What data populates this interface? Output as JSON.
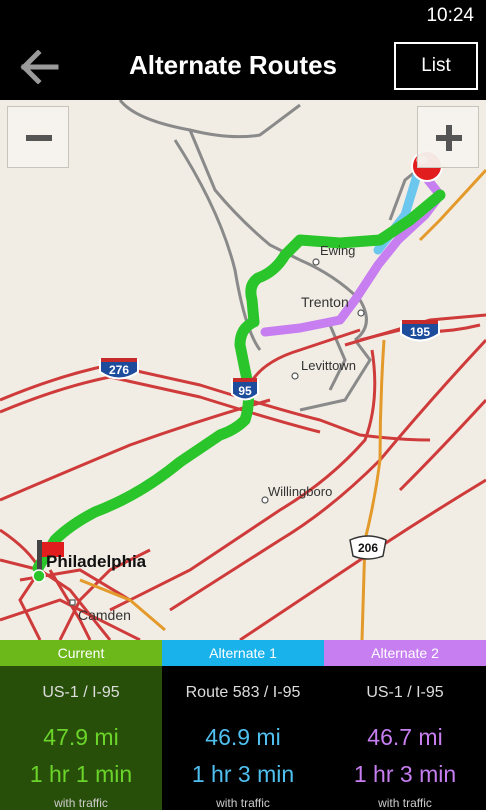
{
  "status": {
    "time": "10:24"
  },
  "header": {
    "title": "Alternate Routes",
    "list_label": "List"
  },
  "map": {
    "places": {
      "ewing": "Ewing",
      "trenton": "Trenton",
      "levittown": "Levittown",
      "willingboro": "Willingboro",
      "philadelphia": "Philadelphia",
      "camden": "Camden"
    },
    "shields": {
      "i276": "276",
      "i95": "95",
      "i195": "195",
      "r206": "206"
    },
    "route_colors": {
      "current": "#2ac52a",
      "alternate1": "#6cc7ee",
      "alternate2": "#c77ef0"
    },
    "icons": [
      "zoom-out-icon",
      "zoom-in-icon",
      "start-flag-icon",
      "destination-pin-icon"
    ]
  },
  "routes": [
    {
      "tab": "Current",
      "road": "US-1 / I-95",
      "distance": "47.9 mi",
      "time": "1 hr 1 min",
      "traffic": "with traffic",
      "tab_color": "#6cb81a",
      "text_color": "#6bd42a",
      "bg": "#284f09"
    },
    {
      "tab": "Alternate 1",
      "road": "Route 583 / I-95",
      "distance": "46.9 mi",
      "time": "1 hr 3 min",
      "traffic": "with traffic",
      "tab_color": "#1ab2ea",
      "text_color": "#4fc0f0",
      "bg": "#000000"
    },
    {
      "tab": "Alternate 2",
      "road": "US-1 / I-95",
      "distance": "46.7 mi",
      "time": "1 hr 3 min",
      "traffic": "with traffic",
      "tab_color": "#c77ef0",
      "text_color": "#c77ef0",
      "bg": "#000000"
    }
  ]
}
